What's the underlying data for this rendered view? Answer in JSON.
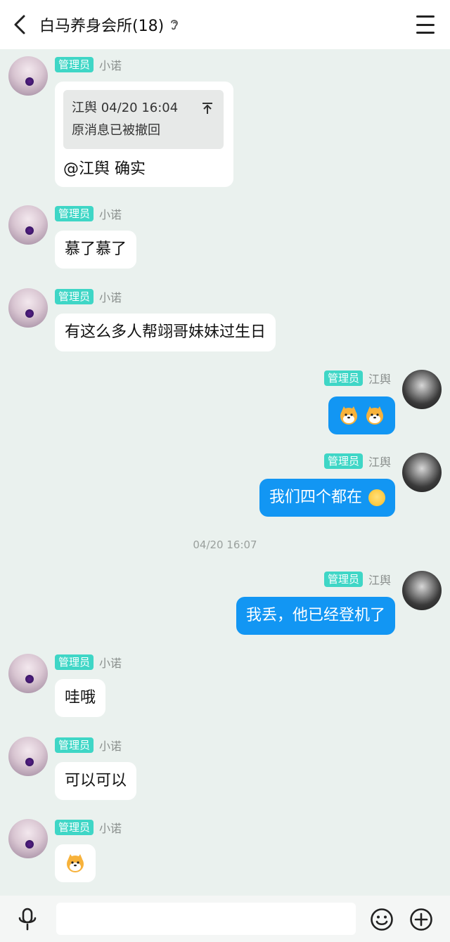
{
  "header": {
    "title": "白马养身会所(18)"
  },
  "badge_label": "管理员",
  "messages": [
    {
      "sender": "小诺",
      "quote": {
        "author_time": "江舆 04/20 16:04",
        "text": "原消息已被撤回"
      },
      "text": "@江舆 确实"
    },
    {
      "sender": "小诺",
      "text": "慕了慕了"
    },
    {
      "sender": "小诺",
      "text": "有这么多人帮翊哥妹妹过生日"
    },
    {
      "sender": "江舆",
      "text": ""
    },
    {
      "sender": "江舆",
      "text": "我们四个都在"
    },
    {
      "sender": "江舆",
      "text": "我丢，他已经登机了"
    },
    {
      "sender": "小诺",
      "text": "哇哦"
    },
    {
      "sender": "小诺",
      "text": "可以可以"
    },
    {
      "sender": "小诺",
      "text": ""
    }
  ],
  "time_separator": "04/20 16:07",
  "input": {
    "placeholder": ""
  },
  "icons": [
    "back-icon",
    "ear-icon",
    "menu-icon",
    "mic-icon",
    "smiley-icon",
    "plus-icon",
    "dog-emoji-icon",
    "laugh-emoji-icon"
  ],
  "colors": {
    "accent_out": "#1296f3",
    "badge": "#3fd6c6",
    "background": "#eaf1ee"
  }
}
